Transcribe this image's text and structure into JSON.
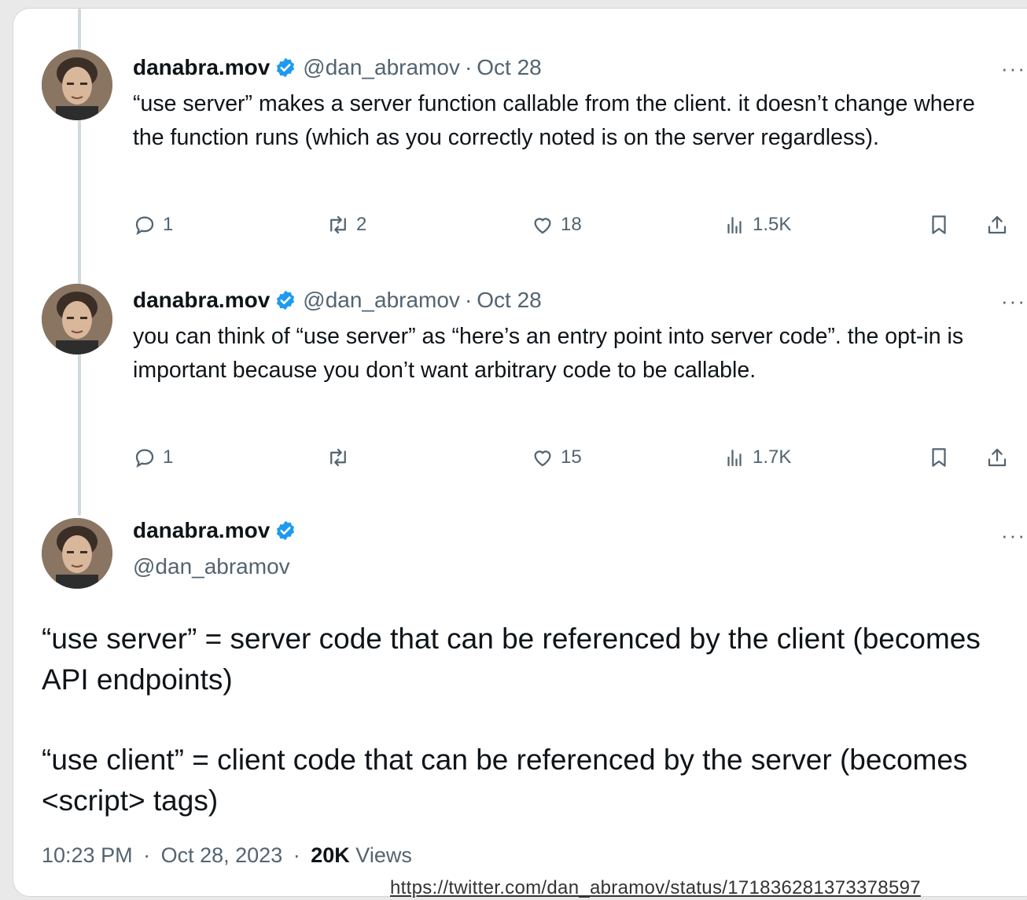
{
  "tweets": [
    {
      "name": "danabra.mov",
      "handle": "@dan_abramov",
      "separator": "·",
      "date": "Oct 28",
      "more": "···",
      "text": "“use server” makes a server function callable from the client. it doesn’t change where the function runs (which as you correctly noted is on the server regardless).",
      "replies": "1",
      "retweets": "2",
      "likes": "18",
      "views": "1.5K"
    },
    {
      "name": "danabra.mov",
      "handle": "@dan_abramov",
      "separator": "·",
      "date": "Oct 28",
      "more": "···",
      "text": "you can think of “use server” as “here’s an entry point into server code”. the opt-in is important because you don’t want arbitrary code to be callable.",
      "replies": "1",
      "retweets": "",
      "likes": "15",
      "views": "1.7K"
    }
  ],
  "main": {
    "name": "danabra.mov",
    "handle": "@dan_abramov",
    "more": "···",
    "paragraph1": "“use server” = server code that can be referenced by the client (becomes API endpoints)",
    "paragraph2": "“use client” = client code that can be referenced by the server (becomes <script> tags)",
    "time": "10:23 PM",
    "date": "Oct 28, 2023",
    "separator": "·",
    "views_count": "20K",
    "views_label": "Views"
  },
  "source_url": "https://twitter.com/dan_abramov/status/171836281373378597",
  "icons": {
    "reply": "reply-icon",
    "retweet": "retweet-icon",
    "like": "heart-icon",
    "views": "analytics-icon",
    "bookmark": "bookmark-icon",
    "share": "share-icon",
    "verified": "verified-badge-icon"
  },
  "colors": {
    "verified_blue": "#1d9bf0",
    "muted_text": "#536471",
    "primary_text": "#0f1419"
  }
}
